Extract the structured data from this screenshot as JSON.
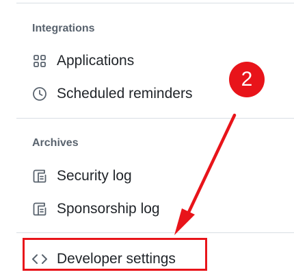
{
  "sections": {
    "integrations": {
      "heading": "Integrations",
      "items": [
        {
          "label": "Applications",
          "icon": "apps-grid-icon"
        },
        {
          "label": "Scheduled reminders",
          "icon": "clock-icon"
        }
      ]
    },
    "archives": {
      "heading": "Archives",
      "items": [
        {
          "label": "Security log",
          "icon": "log-icon"
        },
        {
          "label": "Sponsorship log",
          "icon": "log-icon"
        }
      ]
    },
    "developer": {
      "label": "Developer settings",
      "icon": "code-icon"
    }
  },
  "annotation": {
    "step_number": "2",
    "color": "#e8141a"
  }
}
